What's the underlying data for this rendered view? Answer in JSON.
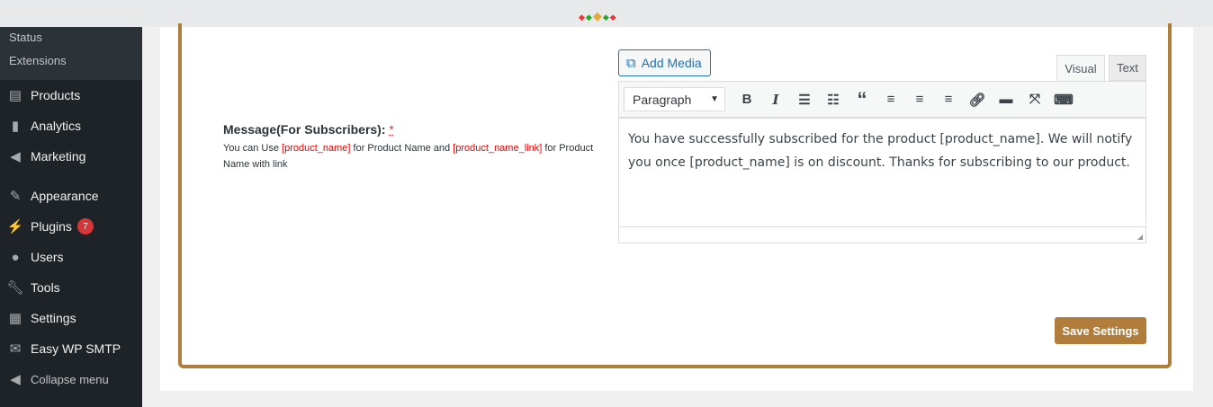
{
  "sidebar": {
    "submenu": [
      "Status",
      "Extensions"
    ],
    "items": [
      {
        "label": "Products",
        "icon": "archive-icon"
      },
      {
        "label": "Analytics",
        "icon": "bar-chart-icon"
      },
      {
        "label": "Marketing",
        "icon": "megaphone-icon"
      },
      {
        "label": "Appearance",
        "icon": "paintbrush-icon"
      },
      {
        "label": "Plugins",
        "icon": "plug-icon",
        "badge": "7"
      },
      {
        "label": "Users",
        "icon": "user-icon"
      },
      {
        "label": "Tools",
        "icon": "wrench-icon"
      },
      {
        "label": "Settings",
        "icon": "settings-icon"
      },
      {
        "label": "Easy WP SMTP",
        "icon": "mail-icon"
      },
      {
        "label": "Collapse menu",
        "icon": "collapse-icon"
      }
    ]
  },
  "form": {
    "label": "Message(For Subscribers):",
    "required": "*",
    "help_prefix": "You can Use ",
    "tag1": "[product_name]",
    "help_mid": " for Product Name and ",
    "tag2": "[product_name_link]",
    "help_suffix": " for Product Name with link",
    "add_media": "Add Media",
    "tab_visual": "Visual",
    "tab_text": "Text",
    "format": "Paragraph",
    "content": "You have successfully subscribed for the product [product_name]. We will notify you once [product_name] is on discount. Thanks for subscribing to our product.",
    "save": "Save Settings"
  },
  "colors": {
    "accent": "#b07d3a",
    "link": "#2271b1",
    "sidebar": "#1d2327"
  }
}
